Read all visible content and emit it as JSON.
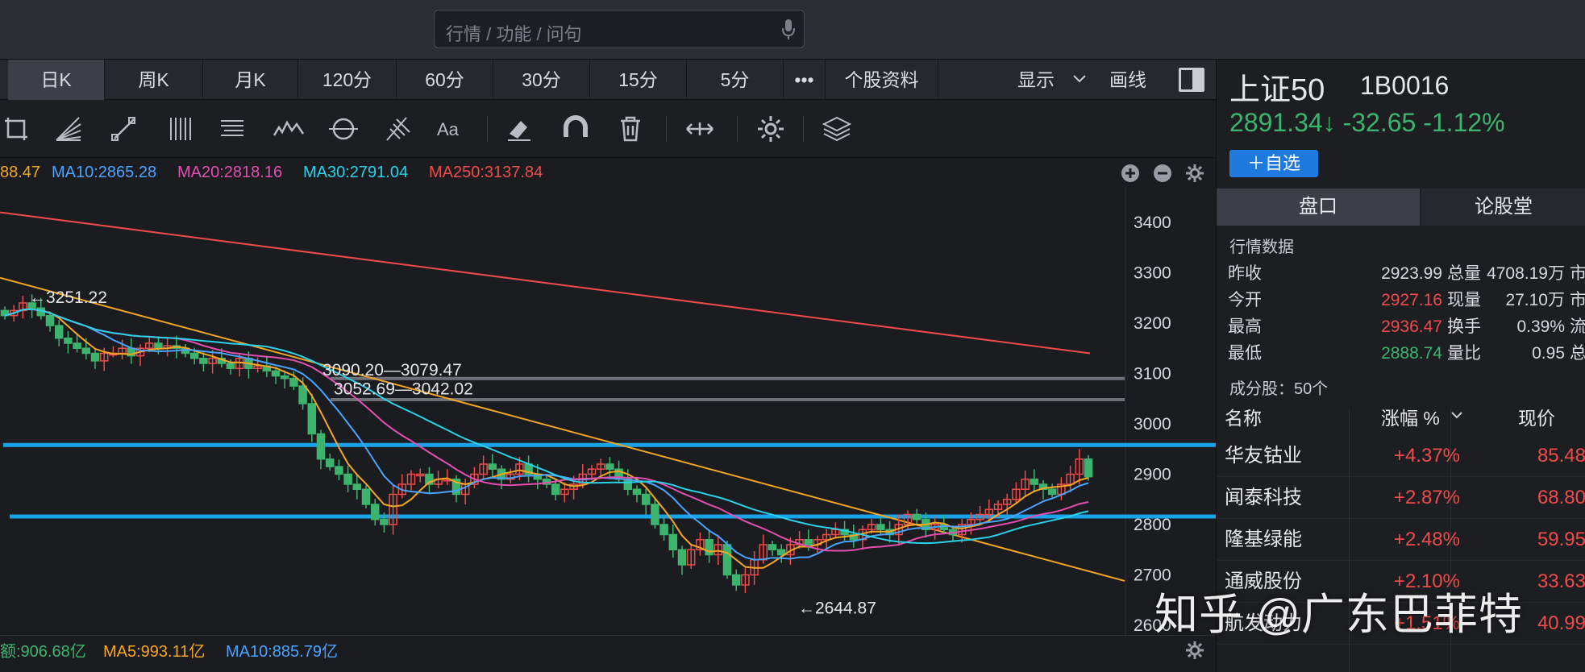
{
  "search": {
    "placeholder": "行情 / 功能 / 问句"
  },
  "period_tabs": [
    "日K",
    "周K",
    "月K",
    "120分",
    "60分",
    "30分",
    "15分",
    "5分",
    "•••",
    "个股资料"
  ],
  "toolbar_right": {
    "display_label": "显示",
    "draw_label": "画线"
  },
  "drawing_tools": [
    "crop-icon",
    "fan-icon",
    "ray-icon",
    "parallel-lines-icon",
    "channel-icon",
    "wave-icon",
    "cycle-icon",
    "fib-icon",
    "text-icon",
    "eraser-icon",
    "magnet-icon",
    "trash-icon",
    "arrows-icon",
    "settings-icon",
    "layers-icon"
  ],
  "ma_legend": [
    {
      "text": "88.47",
      "color": "#f5a623"
    },
    {
      "text": "MA10:2865.28",
      "color": "#4aa3ff"
    },
    {
      "text": "MA20:2818.16",
      "color": "#e24fb1"
    },
    {
      "text": "MA30:2791.04",
      "color": "#2ad1e8"
    },
    {
      "text": "MA250:3137.84",
      "color": "#f04b4b"
    }
  ],
  "volume_legend": [
    {
      "text": "额:906.68亿",
      "color": "#3cb46e"
    },
    {
      "text": "MA5:993.11亿",
      "color": "#f5a623"
    },
    {
      "text": "MA10:885.79亿",
      "color": "#4aa3ff"
    }
  ],
  "chart_data": {
    "type": "candlestick",
    "y_ticks": [
      "3400",
      "3300",
      "3200",
      "3100",
      "3000",
      "2900",
      "2800",
      "2700",
      "2600"
    ],
    "ylim": [
      2600,
      3400
    ],
    "annotations": [
      {
        "text": "←3251.22",
        "price": 3251.22
      },
      {
        "text": "3090.20—3079.47",
        "price": 3090.2
      },
      {
        "text": "3052.69—3042.02",
        "price": 3052.69
      },
      {
        "text": "←2644.87",
        "price": 2644.87
      }
    ],
    "horizontal_levels": [
      {
        "price": 3090,
        "color": "#6e7078"
      },
      {
        "price": 3048,
        "color": "#6e7078"
      },
      {
        "price": 2958,
        "color": "#1aa3e8"
      },
      {
        "price": 2816,
        "color": "#1aa3e8"
      }
    ],
    "trendlines": [
      {
        "from": [
          0,
          3290
        ],
        "to": [
          1,
          2688
        ],
        "color": "#f5a623"
      }
    ],
    "ma250_line": {
      "from": 3420,
      "to": 3140,
      "color": "#f04b4b"
    },
    "candles_close_path": [
      3215,
      3225,
      3240,
      3230,
      3215,
      3195,
      3170,
      3160,
      3150,
      3140,
      3125,
      3140,
      3140,
      3150,
      3135,
      3150,
      3160,
      3150,
      3155,
      3150,
      3140,
      3130,
      3120,
      3130,
      3120,
      3110,
      3130,
      3110,
      3115,
      3105,
      3095,
      3090,
      3075,
      3040,
      2980,
      2930,
      2915,
      2900,
      2880,
      2870,
      2840,
      2810,
      2800,
      2860,
      2880,
      2900,
      2900,
      2880,
      2890,
      2890,
      2860,
      2880,
      2900,
      2920,
      2910,
      2890,
      2900,
      2920,
      2900,
      2890,
      2880,
      2860,
      2870,
      2880,
      2900,
      2910,
      2920,
      2910,
      2890,
      2870,
      2860,
      2840,
      2800,
      2780,
      2750,
      2720,
      2750,
      2770,
      2740,
      2760,
      2700,
      2680,
      2700,
      2730,
      2760,
      2750,
      2740,
      2760,
      2770,
      2760,
      2770,
      2780,
      2790,
      2780,
      2770,
      2790,
      2800,
      2790,
      2780,
      2800,
      2820,
      2810,
      2790,
      2800,
      2790,
      2780,
      2800,
      2810,
      2820,
      2830,
      2840,
      2850,
      2870,
      2890,
      2880,
      2870,
      2860,
      2880,
      2900,
      2930,
      2895
    ]
  },
  "right_panel": {
    "name": "上证50",
    "code": "1B0016",
    "price": "2891.34↓",
    "change": "-32.65",
    "change_pct": "-1.12%",
    "add_label": "＋自选",
    "tab_active": "盘口",
    "tab_inactive": "论股堂",
    "quote_section": "行情数据",
    "quotes": [
      {
        "l1": "昨收",
        "v1": "2923.99",
        "c1": "#d7d9de",
        "l2": "总量",
        "v2": "4708.19万",
        "l3": "市"
      },
      {
        "l1": "今开",
        "v1": "2927.16",
        "c1": "#f04b4b",
        "l2": "现量",
        "v2": "27.10万",
        "l3": "市"
      },
      {
        "l1": "最高",
        "v1": "2936.47",
        "c1": "#f04b4b",
        "l2": "换手",
        "v2": "0.39%",
        "l3": "流"
      },
      {
        "l1": "最低",
        "v1": "2888.74",
        "c1": "#3cb46e",
        "l2": "量比",
        "v2": "0.95",
        "l3": "总"
      }
    ],
    "constituents_label": "成分股：50个",
    "col_name": "名称",
    "col_change": "涨幅 %",
    "col_price": "现价",
    "stocks": [
      {
        "name": "华友钴业",
        "change": "+4.37%",
        "price": "85.48"
      },
      {
        "name": "闻泰科技",
        "change": "+2.87%",
        "price": "68.80"
      },
      {
        "name": "隆基绿能",
        "change": "+2.48%",
        "price": "59.95"
      },
      {
        "name": "通威股份",
        "change": "+2.10%",
        "price": "33.63"
      },
      {
        "name": "航发动力",
        "change": "+1.51%",
        "price": "40.99"
      }
    ]
  },
  "watermark": "知乎 @广东巴菲特"
}
